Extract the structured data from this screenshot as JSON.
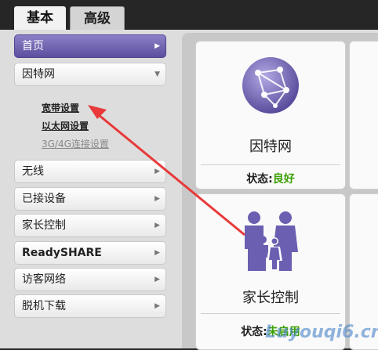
{
  "tabs": {
    "basic": "基本",
    "advanced": "高级"
  },
  "sidebar": {
    "home": "首页",
    "internet": "因特网",
    "sub": {
      "broadband": "宽带设置",
      "ethernet": "以太网设置",
      "mobile": "3G/4G连接设置"
    },
    "wireless": "无线",
    "attached": "已接设备",
    "parental": "家长控制",
    "readyshare": "ReadySHARE",
    "guest": "访客网络",
    "offline": "脱机下载"
  },
  "cards": {
    "internet": {
      "title": "因特网",
      "status_label": "状态:",
      "status_value": "良好"
    },
    "parental": {
      "title": "家长控制",
      "status_label": "状态:",
      "status_value": "未启用"
    }
  },
  "watermark": "Luyouqi6.cn",
  "colors": {
    "accent": "#6a5fb0",
    "good": "#3aa000",
    "annotation": "#e83a3a"
  }
}
